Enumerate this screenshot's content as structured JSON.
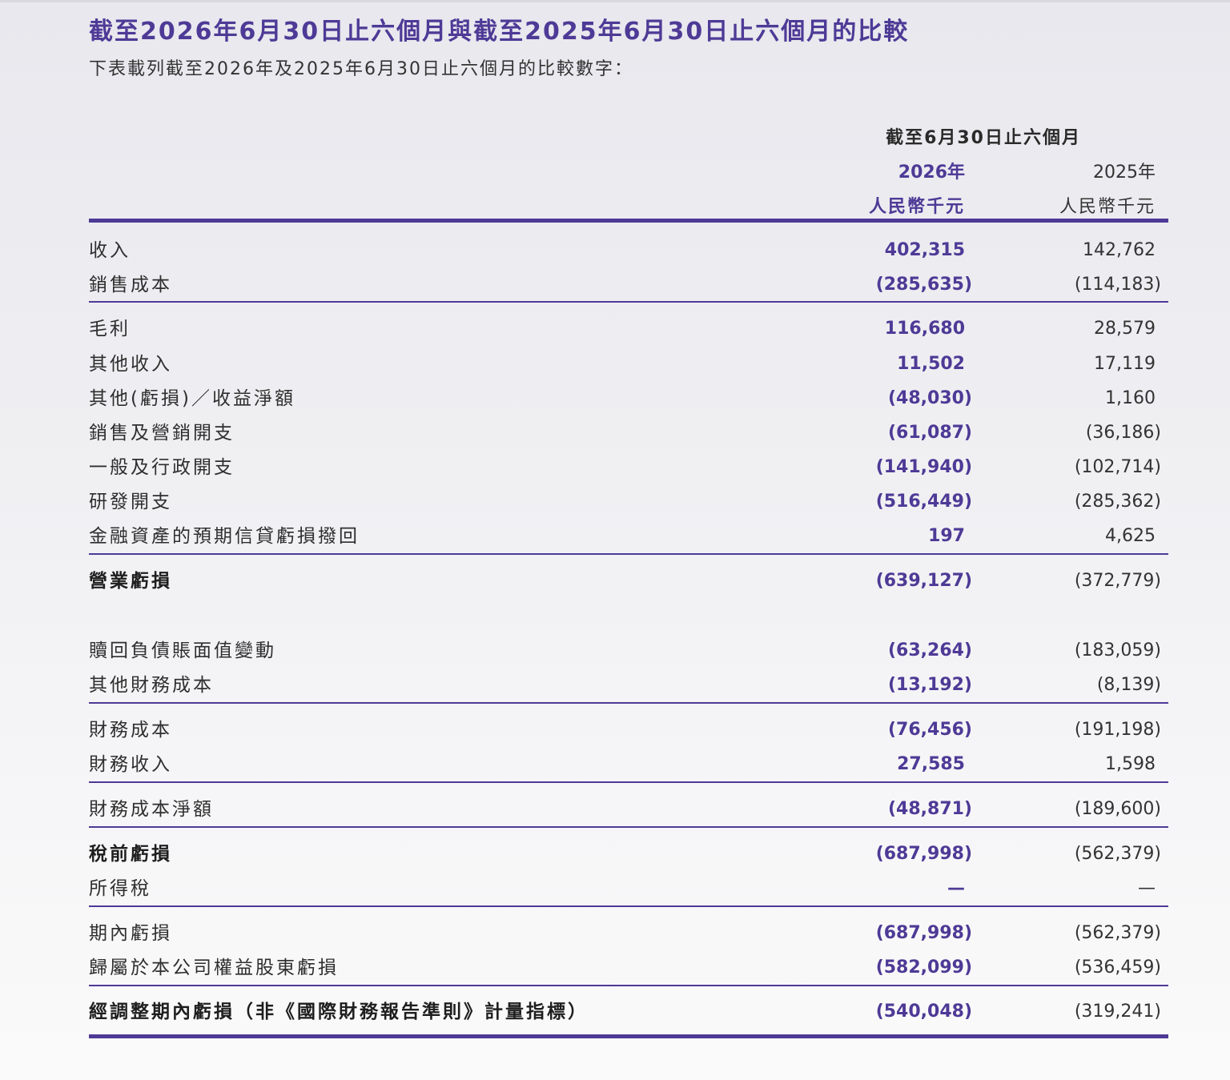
{
  "document": {
    "title": "截至2026年6月30日止六個月與截至2025年6月30日止六個月的比較",
    "subtitle": "下表載列截至2026年及2025年6月30日止六個月的比較數字："
  },
  "table": {
    "header": {
      "period": "截至6月30日止六個月",
      "year_current": "2026年",
      "year_prior": "2025年",
      "currency_current": "人民幣千元",
      "currency_prior": "人民幣千元"
    },
    "rows": [
      {
        "label": "收入",
        "current": "402,315",
        "prior": "142,762"
      },
      {
        "label": "銷售成本",
        "current": "(285,635)",
        "prior": "(114,183)"
      },
      {
        "label": "毛利",
        "current": "116,680",
        "prior": "28,579"
      },
      {
        "label": "其他收入",
        "current": "11,502",
        "prior": "17,119"
      },
      {
        "label": "其他(虧損)／收益淨額",
        "current": "(48,030)",
        "prior": "1,160"
      },
      {
        "label": "銷售及營銷開支",
        "current": "(61,087)",
        "prior": "(36,186)"
      },
      {
        "label": "一般及行政開支",
        "current": "(141,940)",
        "prior": "(102,714)"
      },
      {
        "label": "研發開支",
        "current": "(516,449)",
        "prior": "(285,362)"
      },
      {
        "label": "金融資產的預期信貸虧損撥回",
        "current": "197",
        "prior": "4,625"
      },
      {
        "label": "營業虧損",
        "current": "(639,127)",
        "prior": "(372,779)"
      },
      {
        "label": "贖回負債賬面值變動",
        "current": "(63,264)",
        "prior": "(183,059)"
      },
      {
        "label": "其他財務成本",
        "current": "(13,192)",
        "prior": "(8,139)"
      },
      {
        "label": "財務成本",
        "current": "(76,456)",
        "prior": "(191,198)"
      },
      {
        "label": "財務收入",
        "current": "27,585",
        "prior": "1,598"
      },
      {
        "label": "財務成本淨額",
        "current": "(48,871)",
        "prior": "(189,600)"
      },
      {
        "label": "稅前虧損",
        "current": "(687,998)",
        "prior": "(562,379)"
      },
      {
        "label": "所得稅",
        "current": "—",
        "prior": "—"
      },
      {
        "label": "期內虧損",
        "current": "(687,998)",
        "prior": "(562,379)"
      },
      {
        "label": "歸屬於本公司權益股東虧損",
        "current": "(582,099)",
        "prior": "(536,459)"
      },
      {
        "label": "經調整期內虧損（非《國際財務報告準則》計量指標）",
        "current": "(540,048)",
        "prior": "(319,241)"
      }
    ]
  },
  "colors": {
    "accent": "#4e3a96",
    "text": "#2e2e2e"
  }
}
